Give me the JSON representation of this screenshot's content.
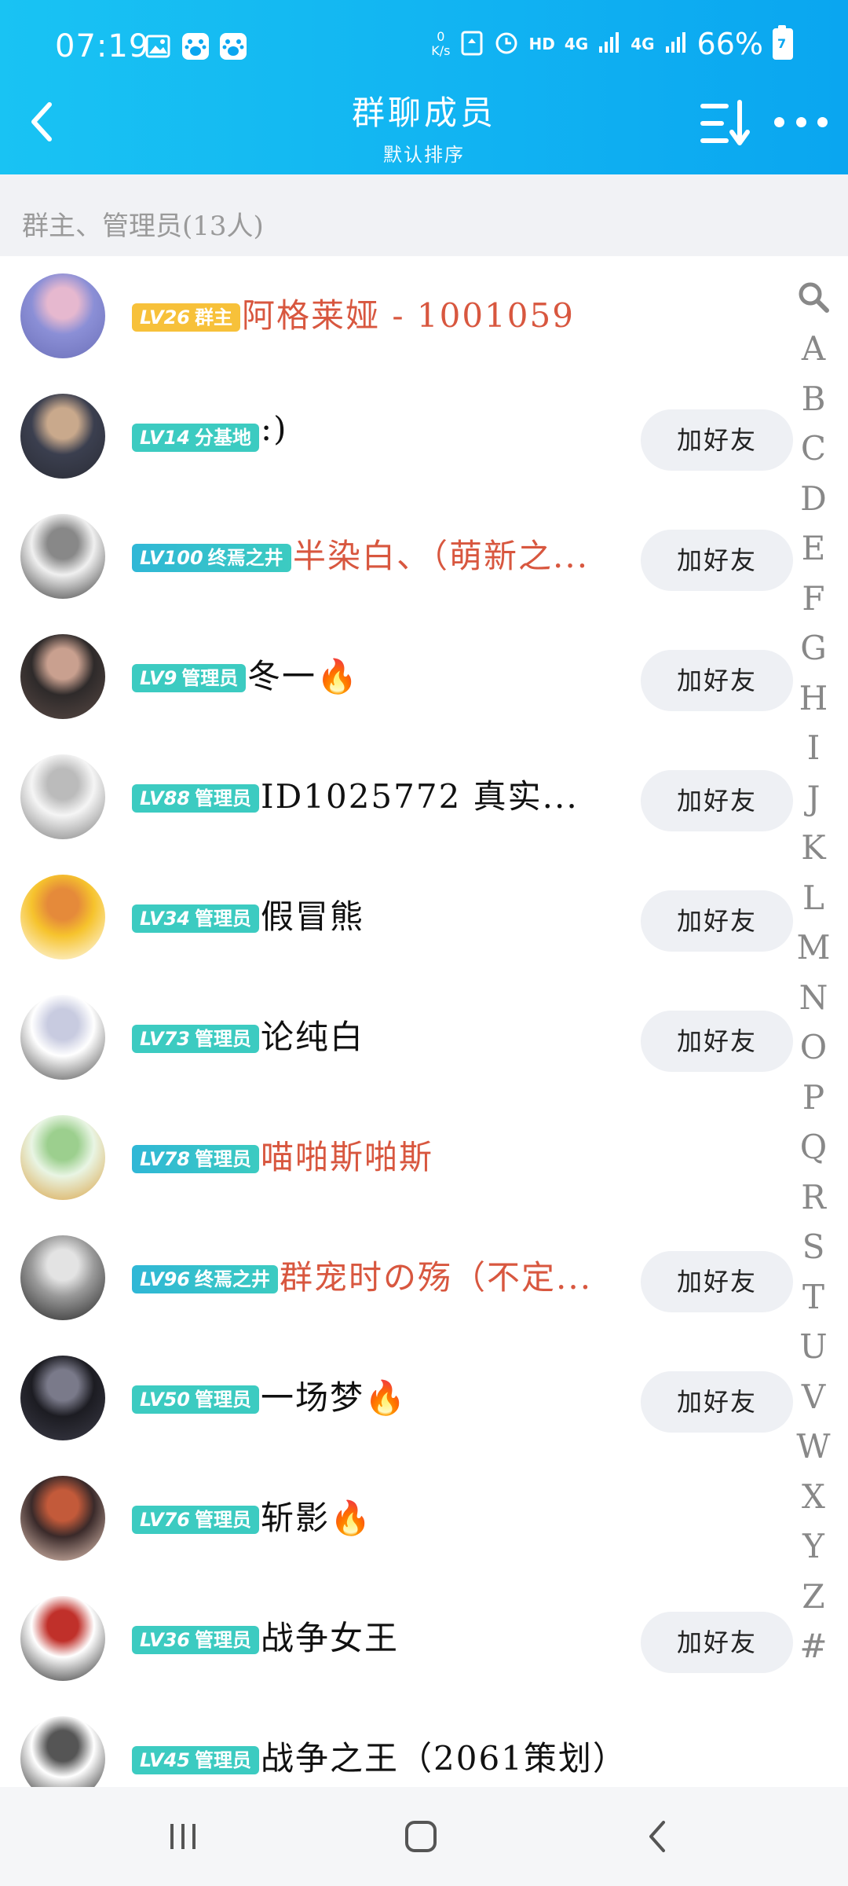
{
  "status_bar": {
    "time": "07:19",
    "net_speed_value": "0",
    "net_speed_unit": "K/s",
    "hd": "HD",
    "signal1": "4G",
    "signal2": "4G",
    "battery_percent": "66%",
    "battery_badge": "7"
  },
  "header": {
    "title": "群聊成员",
    "subtitle": "默认排序"
  },
  "section": {
    "title": "群主、管理员(13人)"
  },
  "add_friend_label": "加好友",
  "members": [
    {
      "level": "LV26",
      "role": "群主",
      "name": "阿格莱娅 - 1001059",
      "name_color": "red",
      "badge": "owner",
      "has_add": false,
      "avatar_colors": [
        "#8b8fd6",
        "#e6b8cf",
        "#6b6fb8"
      ]
    },
    {
      "level": "LV14",
      "role": "分基地",
      "name": ":)",
      "name_color": "black",
      "badge": "admin",
      "has_add": true,
      "avatar_colors": [
        "#3b3f4f",
        "#c9a98c",
        "#2a2c35"
      ]
    },
    {
      "level": "LV100",
      "role": "终焉之井",
      "name": "半染白、（萌新之...",
      "name_color": "red",
      "badge": "special",
      "has_add": true,
      "avatar_colors": [
        "#f0f0f0",
        "#888",
        "#333"
      ]
    },
    {
      "level": "LV9",
      "role": "管理员",
      "name": "冬一🔥",
      "name_color": "black",
      "badge": "admin",
      "has_add": true,
      "avatar_colors": [
        "#2e2a2a",
        "#c9a08f",
        "#5a4a45"
      ]
    },
    {
      "level": "LV88",
      "role": "管理员",
      "name": "ID1025772 真实...",
      "name_color": "black",
      "badge": "admin",
      "has_add": true,
      "avatar_colors": [
        "#f5f5f5",
        "#bbb",
        "#777"
      ]
    },
    {
      "level": "LV34",
      "role": "管理员",
      "name": "假冒熊",
      "name_color": "black",
      "badge": "admin",
      "has_add": true,
      "avatar_colors": [
        "#f6c32d",
        "#e58a3a",
        "#ffffff"
      ]
    },
    {
      "level": "LV73",
      "role": "管理员",
      "name": "论纯白",
      "name_color": "black",
      "badge": "admin",
      "has_add": true,
      "avatar_colors": [
        "#ffffff",
        "#c8cbe0",
        "#444"
      ]
    },
    {
      "level": "LV78",
      "role": "管理员",
      "name": "喵啪斯啪斯",
      "name_color": "red",
      "badge": "special",
      "has_add": false,
      "avatar_colors": [
        "#e9f5e4",
        "#9ccf8e",
        "#d9a040"
      ]
    },
    {
      "level": "LV96",
      "role": "终焉之井",
      "name": "群宠时の殇（不定...",
      "name_color": "red",
      "badge": "special",
      "has_add": true,
      "avatar_colors": [
        "#9a9a9a",
        "#e3e3e3",
        "#222"
      ]
    },
    {
      "level": "LV50",
      "role": "管理员",
      "name": "一场梦🔥",
      "name_color": "black",
      "badge": "admin",
      "has_add": true,
      "avatar_colors": [
        "#1c1c22",
        "#7a7a8a",
        "#3c3c48"
      ]
    },
    {
      "level": "LV76",
      "role": "管理员",
      "name": "斩影🔥",
      "name_color": "black",
      "badge": "admin",
      "has_add": false,
      "avatar_colors": [
        "#3a2a2a",
        "#c35a3a",
        "#f0d0c0"
      ]
    },
    {
      "level": "LV36",
      "role": "管理员",
      "name": "战争女王",
      "name_color": "black",
      "badge": "admin",
      "has_add": true,
      "avatar_colors": [
        "#ffffff",
        "#c0302a",
        "#222"
      ]
    },
    {
      "level": "LV45",
      "role": "管理员",
      "name": "战争之王（2061策划）",
      "name_color": "black",
      "badge": "admin",
      "has_add": false,
      "avatar_colors": [
        "#ffffff",
        "#555",
        "#111"
      ]
    }
  ],
  "index_letters": [
    "A",
    "B",
    "C",
    "D",
    "E",
    "F",
    "G",
    "H",
    "I",
    "J",
    "K",
    "L",
    "M",
    "N",
    "O",
    "P",
    "Q",
    "R",
    "S",
    "T",
    "U",
    "V",
    "W",
    "X",
    "Y",
    "Z",
    "#"
  ],
  "colors": {
    "header_start": "#19c3f3",
    "header_end": "#0aa6f0",
    "owner_badge": "#f7c13a",
    "admin_badge": "#3ccbc1",
    "red_name": "#d8573f"
  }
}
